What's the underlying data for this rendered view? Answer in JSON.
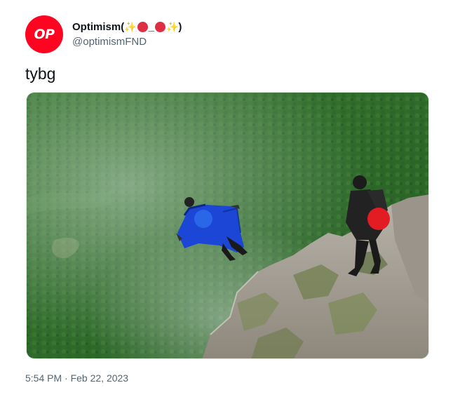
{
  "author": {
    "avatar_text": "OP",
    "display_name": "Optimism",
    "name_decor_open": " (",
    "name_decor_sep": "_",
    "name_decor_close": ")",
    "sparkle_glyph": "✨",
    "handle": "@optimismFND"
  },
  "tweet": {
    "text": "tybg",
    "timestamp": "5:54 PM · Feb 22, 2023"
  },
  "media": {
    "alt_description": "wingsuit flyer jumping from cliff",
    "colors": {
      "forest": "#2f6b2a",
      "wingsuit": "#1b46d6",
      "blue_dot": "#2a66e8",
      "red_dot": "#e31b23"
    }
  },
  "colors": {
    "brand": "#ff0420",
    "text_primary": "#0f1419",
    "text_secondary": "#536471"
  }
}
